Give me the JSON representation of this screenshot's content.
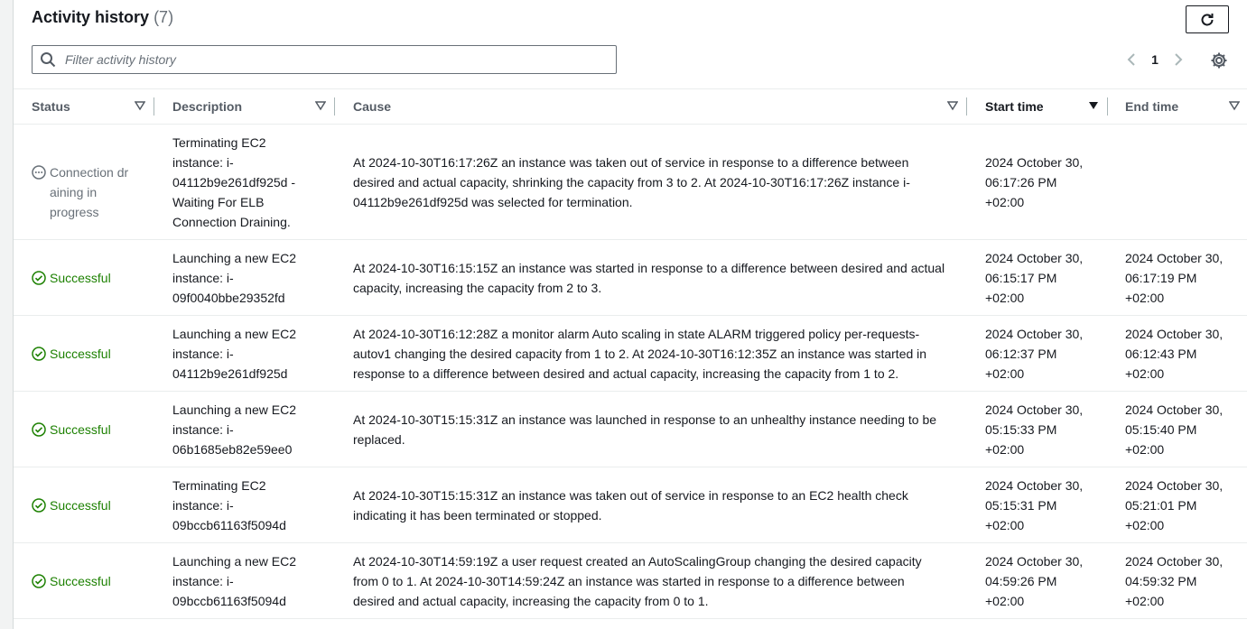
{
  "header": {
    "title": "Activity history",
    "count": "(7)"
  },
  "search": {
    "placeholder": "Filter activity history"
  },
  "pagination": {
    "current_page": "1"
  },
  "columns": {
    "status": "Status",
    "description": "Description",
    "cause": "Cause",
    "start_time": "Start time",
    "end_time": "End time"
  },
  "rows": [
    {
      "status": "Connection dr aining in progress",
      "status_type": "in-progress",
      "description": "Terminating EC2 instance: i-04112b9e261df925d - Waiting For ELB Connection Draining.",
      "cause": "At 2024-10-30T16:17:26Z an instance was taken out of service in response to a difference between desired and actual capacity, shrinking the capacity from 3 to 2. At 2024-10-30T16:17:26Z instance i-04112b9e261df925d was selected for termination.",
      "start_time": "2024 October 30, 06:17:26 PM +02:00",
      "end_time": ""
    },
    {
      "status": "Successful",
      "status_type": "success",
      "description": "Launching a new EC2 instance: i-09f0040bbe29352fd",
      "cause": "At 2024-10-30T16:15:15Z an instance was started in response to a difference between desired and actual capacity, increasing the capacity from 2 to 3.",
      "start_time": "2024 October 30, 06:15:17 PM +02:00",
      "end_time": "2024 October 30, 06:17:19 PM +02:00"
    },
    {
      "status": "Successful",
      "status_type": "success",
      "description": "Launching a new EC2 instance: i-04112b9e261df925d",
      "cause": "At 2024-10-30T16:12:28Z a monitor alarm Auto scaling in state ALARM triggered policy per-requests-autov1 changing the desired capacity from 1 to 2. At 2024-10-30T16:12:35Z an instance was started in response to a difference between desired and actual capacity, increasing the capacity from 1 to 2.",
      "start_time": "2024 October 30, 06:12:37 PM +02:00",
      "end_time": "2024 October 30, 06:12:43 PM +02:00"
    },
    {
      "status": "Successful",
      "status_type": "success",
      "description": "Launching a new EC2 instance: i-06b1685eb82e59ee0",
      "cause": "At 2024-10-30T15:15:31Z an instance was launched in response to an unhealthy instance needing to be replaced.",
      "start_time": "2024 October 30, 05:15:33 PM +02:00",
      "end_time": "2024 October 30, 05:15:40 PM +02:00"
    },
    {
      "status": "Successful",
      "status_type": "success",
      "description": "Terminating EC2 instance: i-09bccb61163f5094d",
      "cause": "At 2024-10-30T15:15:31Z an instance was taken out of service in response to an EC2 health check indicating it has been terminated or stopped.",
      "start_time": "2024 October 30, 05:15:31 PM +02:00",
      "end_time": "2024 October 30, 05:21:01 PM +02:00"
    },
    {
      "status": "Successful",
      "status_type": "success",
      "description": "Launching a new EC2 instance: i-09bccb61163f5094d",
      "cause": "At 2024-10-30T14:59:19Z a user request created an AutoScalingGroup changing the desired capacity from 0 to 1. At 2024-10-30T14:59:24Z an instance was started in response to a difference between desired and actual capacity, increasing the capacity from 0 to 1.",
      "start_time": "2024 October 30, 04:59:26 PM +02:00",
      "end_time": "2024 October 30, 04:59:32 PM +02:00"
    }
  ],
  "icons": {
    "refresh": "refresh-icon",
    "search": "search-icon",
    "prev": "chevron-left-icon",
    "next": "chevron-right-icon",
    "settings": "gear-icon",
    "sort": "caret-down-icon",
    "success": "check-circle-icon",
    "in_progress": "ellipsis-circle-icon"
  },
  "colors": {
    "success": "#1d8102",
    "muted": "#687078",
    "text": "#16191f"
  }
}
